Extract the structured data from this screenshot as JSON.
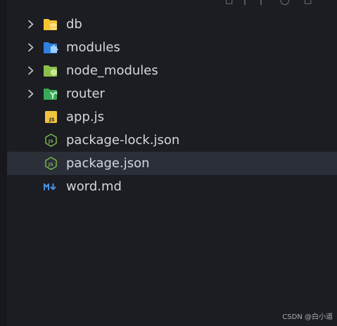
{
  "explorer": {
    "items": [
      {
        "label": "db",
        "kind": "folder",
        "icon": "db-folder-icon"
      },
      {
        "label": "modules",
        "kind": "folder",
        "icon": "modules-folder-icon"
      },
      {
        "label": "node_modules",
        "kind": "folder",
        "icon": "node-modules-folder-icon"
      },
      {
        "label": "router",
        "kind": "folder",
        "icon": "router-folder-icon"
      },
      {
        "label": "app.js",
        "kind": "file",
        "icon": "javascript-file-icon"
      },
      {
        "label": "package-lock.json",
        "kind": "file",
        "icon": "nodejs-file-icon"
      },
      {
        "label": "package.json",
        "kind": "file",
        "icon": "nodejs-file-icon",
        "selected": true
      },
      {
        "label": "word.md",
        "kind": "file",
        "icon": "markdown-file-icon"
      }
    ]
  },
  "watermark": {
    "text": "CSDN @白小道"
  },
  "colors": {
    "background": "#1b1d23",
    "selected_row": "#2b2f38",
    "label_text": "#d4d7dd",
    "chevron": "#c5c8ce",
    "db_folder": "#f2c531",
    "modules_folder": "#2f7fe0",
    "node_folder": "#8cc04b",
    "router_folder": "#39a857",
    "js_badge": "#f0c43c",
    "node_hex": "#78b34a",
    "markdown": "#4a90e2"
  }
}
